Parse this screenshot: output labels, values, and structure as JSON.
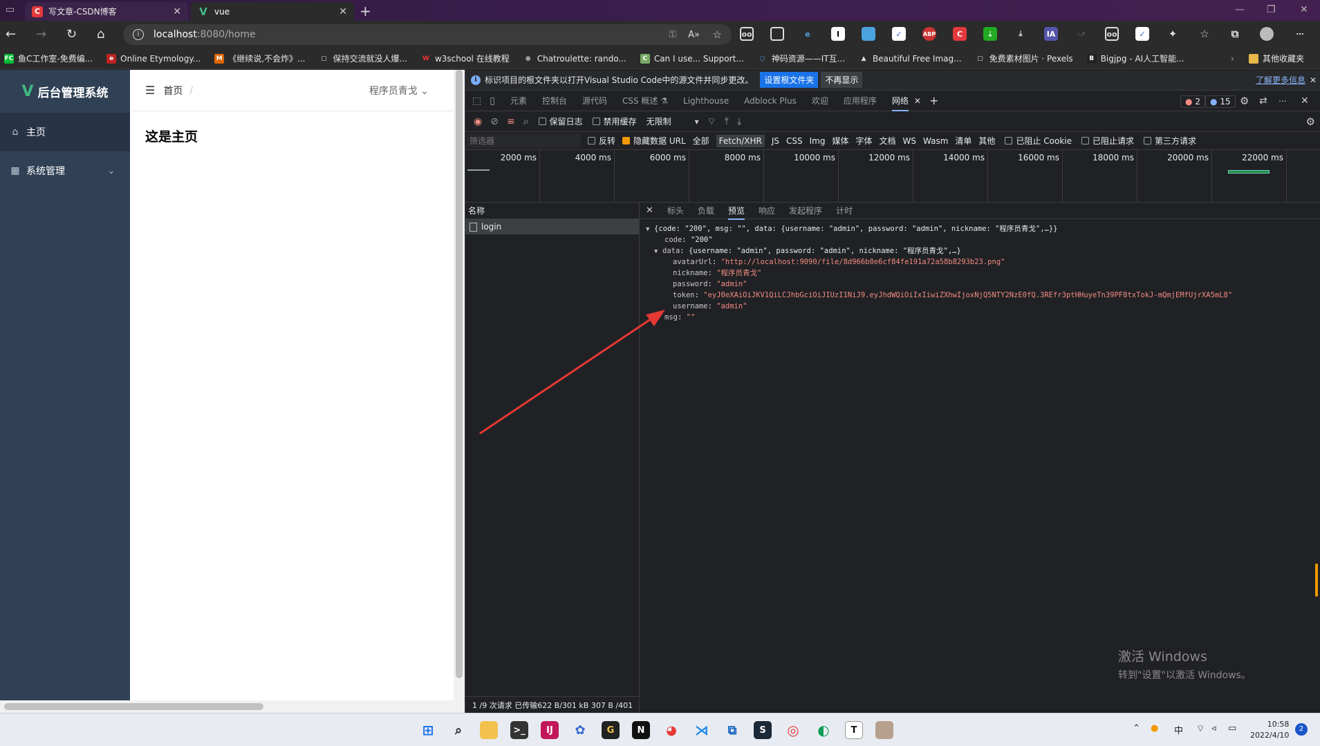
{
  "browser": {
    "tabs": [
      {
        "title": "写文章-CSDN博客",
        "icon": "csdn-icon",
        "color": "#e4393c"
      },
      {
        "title": "vue",
        "icon": "vue-icon",
        "color": "#41b883"
      }
    ],
    "url_host": "localhost",
    "url_path": ":8080/home"
  },
  "bookmarks": [
    {
      "label": "鱼C工作室-免费编...",
      "icon": "FC",
      "color": "#0b3"
    },
    {
      "label": "Online Etymology...",
      "icon": "e",
      "color": "#b22"
    },
    {
      "label": "《继续说,不会炸》...",
      "icon": "M",
      "color": "#d60"
    },
    {
      "label": "保持交流就没人爆...",
      "icon": "▢",
      "color": "#555"
    },
    {
      "label": "w3school 在线教程",
      "icon": "W",
      "color": "#c33"
    },
    {
      "label": "Chatroulette: rando...",
      "icon": "●",
      "color": "#333"
    },
    {
      "label": "Can I use... Support...",
      "icon": "C",
      "color": "#7a6"
    },
    {
      "label": "神码资源——IT互...",
      "icon": "○",
      "color": "#36c"
    },
    {
      "label": "Beautiful Free Imag...",
      "icon": "▲",
      "color": "#333"
    },
    {
      "label": "免费素材图片 · Pexels",
      "icon": "▢",
      "color": "#555"
    },
    {
      "label": "Bigjpg - AI人工智能...",
      "icon": "B",
      "color": "#222"
    }
  ],
  "other_bookmarks": "其他收藏夹",
  "app": {
    "logo_text": "后台管理系统",
    "menu": [
      {
        "label": "主页",
        "icon": "home-icon"
      },
      {
        "label": "系统管理",
        "icon": "grid-icon"
      }
    ],
    "breadcrumb": "首页",
    "breadcrumb_sep": "/",
    "username": "程序员青戈",
    "page_title": "这是主页"
  },
  "devtools": {
    "info_text": "标识项目的根文件夹以打开Visual Studio Code中的源文件并同步更改。",
    "info_btn_primary": "设置根文件夹",
    "info_btn_secondary": "不再显示",
    "info_link": "了解更多信息",
    "tabs": [
      "元素",
      "控制台",
      "源代码",
      "CSS 概述 ⚗",
      "Lighthouse",
      "Adblock Plus",
      "欢迎",
      "应用程序",
      "网络"
    ],
    "active_tab": "网络",
    "error_count": "2",
    "message_count": "15",
    "toolbar": {
      "preserve_log": "保留日志",
      "disable_cache": "禁用缓存",
      "throttle": "无限制"
    },
    "filter_placeholder": "筛选器",
    "filters": [
      "反转",
      "隐藏数据 URL",
      "全部",
      "Fetch/XHR",
      "JS",
      "CSS",
      "Img",
      "媒体",
      "字体",
      "文档",
      "WS",
      "Wasm",
      "清单",
      "其他",
      "已阻止 Cookie",
      "已阻止请求",
      "第三方请求"
    ],
    "timeline_labels": [
      "2000 ms",
      "4000 ms",
      "6000 ms",
      "8000 ms",
      "10000 ms",
      "12000 ms",
      "14000 ms",
      "16000 ms",
      "18000 ms",
      "20000 ms",
      "22000 ms"
    ],
    "name_header": "名称",
    "request_name": "login",
    "status_bar": "1 /9 次请求  已传输622 B/301 kB  307 B /401",
    "detail_tabs": [
      "标头",
      "负载",
      "预览",
      "响应",
      "发起程序",
      "计时"
    ],
    "active_detail_tab": "预览",
    "preview": {
      "summary": "{code: \"200\", msg: \"\", data: {username: \"admin\", password: \"admin\", nickname: \"程序员青戈\",…}}",
      "code": "\"200\"",
      "data_summary": "{username: \"admin\", password: \"admin\", nickname: \"程序员青戈\",…}",
      "avatarUrl": "\"http://localhost:9090/file/8d966b0e6cf84fe191a72a58b8293b23.png\"",
      "nickname": "\"程序员青戈\"",
      "password": "\"admin\"",
      "token": "\"eyJ0eXAiOiJKV1QiLCJhbGciOiJIUzI1NiJ9.eyJhdWQiOiIxIiwiZXhwIjoxNjQ5NTY2NzE0fQ.3REfr3ptHHuyeTn39PF8txTokJ-mQmjEMfUjrXA5mL8\"",
      "username": "\"admin\"",
      "msg": "\"\""
    }
  },
  "watermark": {
    "line1": "激活 Windows",
    "line2": "转到\"设置\"以激活 Windows。"
  },
  "clock": {
    "time": "10:58",
    "date": "2022/4/10"
  },
  "tray": {
    "ime": "中",
    "notifications": "2"
  },
  "colors": {
    "sidebar": "#304156",
    "sidebar_active": "#263445",
    "vue_green": "#41b883",
    "annotation_arrow": "#e53935"
  }
}
